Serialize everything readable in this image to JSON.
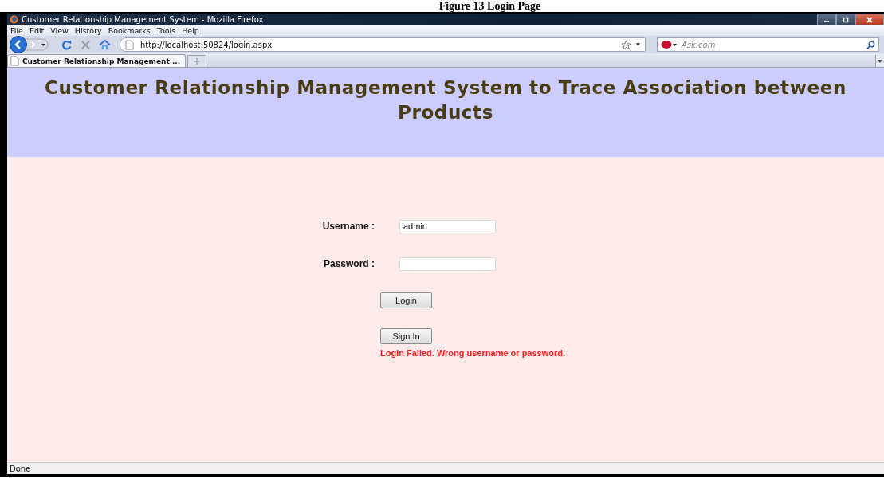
{
  "caption": "Figure 13 Login Page",
  "window": {
    "title": "Customer Relationship Management System - Mozilla Firefox"
  },
  "menu": [
    "File",
    "Edit",
    "View",
    "History",
    "Bookmarks",
    "Tools",
    "Help"
  ],
  "address_bar": {
    "value": "http://localhost:50824/login.aspx"
  },
  "search": {
    "placeholder": "Ask.com"
  },
  "tabs": [
    {
      "label": "Customer Relationship Management ...",
      "selected": true
    }
  ],
  "page": {
    "heading": "Customer Relationship Management System to Trace Association between Products",
    "fields": [
      {
        "label": "Username :",
        "value": "admin"
      },
      {
        "label": "Password :"
      }
    ],
    "buttons": [
      "Login",
      "Sign In"
    ],
    "error": "Login Failed. Wrong username or password."
  },
  "status_bar": "Done"
}
